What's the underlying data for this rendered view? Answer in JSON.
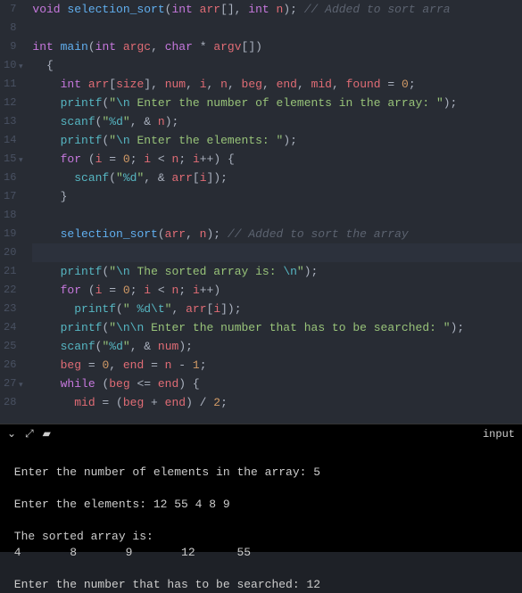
{
  "editor": {
    "lines": [
      {
        "num": "7",
        "fold": false,
        "tokens": [
          {
            "t": "void ",
            "c": "kw-type"
          },
          {
            "t": "selection_sort",
            "c": "fn"
          },
          {
            "t": "(",
            "c": "punct"
          },
          {
            "t": "int ",
            "c": "kw-type"
          },
          {
            "t": "arr",
            "c": "ident"
          },
          {
            "t": "[], ",
            "c": "punct"
          },
          {
            "t": "int ",
            "c": "kw-type"
          },
          {
            "t": "n",
            "c": "ident"
          },
          {
            "t": "); ",
            "c": "punct"
          },
          {
            "t": "// Added to sort arra",
            "c": "cmt"
          }
        ]
      },
      {
        "num": "8",
        "fold": false,
        "tokens": []
      },
      {
        "num": "9",
        "fold": false,
        "tokens": [
          {
            "t": "int ",
            "c": "kw-type"
          },
          {
            "t": "main",
            "c": "fn"
          },
          {
            "t": "(",
            "c": "punct"
          },
          {
            "t": "int ",
            "c": "kw-type"
          },
          {
            "t": "argc",
            "c": "ident"
          },
          {
            "t": ", ",
            "c": "punct"
          },
          {
            "t": "char ",
            "c": "kw-type"
          },
          {
            "t": "* ",
            "c": "op"
          },
          {
            "t": "argv",
            "c": "ident"
          },
          {
            "t": "[])",
            "c": "punct"
          }
        ]
      },
      {
        "num": "10",
        "fold": true,
        "tokens": [
          {
            "t": "  {",
            "c": "punct"
          }
        ]
      },
      {
        "num": "11",
        "fold": false,
        "tokens": [
          {
            "t": "    ",
            "c": "plain"
          },
          {
            "t": "int ",
            "c": "kw-type"
          },
          {
            "t": "arr",
            "c": "ident"
          },
          {
            "t": "[",
            "c": "punct"
          },
          {
            "t": "size",
            "c": "ident"
          },
          {
            "t": "], ",
            "c": "punct"
          },
          {
            "t": "num",
            "c": "ident"
          },
          {
            "t": ", ",
            "c": "punct"
          },
          {
            "t": "i",
            "c": "ident"
          },
          {
            "t": ", ",
            "c": "punct"
          },
          {
            "t": "n",
            "c": "ident"
          },
          {
            "t": ", ",
            "c": "punct"
          },
          {
            "t": "beg",
            "c": "ident"
          },
          {
            "t": ", ",
            "c": "punct"
          },
          {
            "t": "end",
            "c": "ident"
          },
          {
            "t": ", ",
            "c": "punct"
          },
          {
            "t": "mid",
            "c": "ident"
          },
          {
            "t": ", ",
            "c": "punct"
          },
          {
            "t": "found",
            "c": "ident"
          },
          {
            "t": " = ",
            "c": "op"
          },
          {
            "t": "0",
            "c": "num"
          },
          {
            "t": ";",
            "c": "punct"
          }
        ]
      },
      {
        "num": "12",
        "fold": false,
        "tokens": [
          {
            "t": "    ",
            "c": "plain"
          },
          {
            "t": "printf",
            "c": "fn-call"
          },
          {
            "t": "(",
            "c": "punct"
          },
          {
            "t": "\"",
            "c": "str"
          },
          {
            "t": "\\n",
            "c": "esc"
          },
          {
            "t": " Enter the number of elements in the array: ",
            "c": "str"
          },
          {
            "t": "\"",
            "c": "str"
          },
          {
            "t": ");",
            "c": "punct"
          }
        ]
      },
      {
        "num": "13",
        "fold": false,
        "tokens": [
          {
            "t": "    ",
            "c": "plain"
          },
          {
            "t": "scanf",
            "c": "fn-call"
          },
          {
            "t": "(",
            "c": "punct"
          },
          {
            "t": "\"",
            "c": "str"
          },
          {
            "t": "%d",
            "c": "esc"
          },
          {
            "t": "\"",
            "c": "str"
          },
          {
            "t": ", & ",
            "c": "punct"
          },
          {
            "t": "n",
            "c": "ident"
          },
          {
            "t": ");",
            "c": "punct"
          }
        ]
      },
      {
        "num": "14",
        "fold": false,
        "tokens": [
          {
            "t": "    ",
            "c": "plain"
          },
          {
            "t": "printf",
            "c": "fn-call"
          },
          {
            "t": "(",
            "c": "punct"
          },
          {
            "t": "\"",
            "c": "str"
          },
          {
            "t": "\\n",
            "c": "esc"
          },
          {
            "t": " Enter the elements: ",
            "c": "str"
          },
          {
            "t": "\"",
            "c": "str"
          },
          {
            "t": ");",
            "c": "punct"
          }
        ]
      },
      {
        "num": "15",
        "fold": true,
        "tokens": [
          {
            "t": "    ",
            "c": "plain"
          },
          {
            "t": "for ",
            "c": "kw-ctrl"
          },
          {
            "t": "(",
            "c": "punct"
          },
          {
            "t": "i",
            "c": "ident"
          },
          {
            "t": " = ",
            "c": "op"
          },
          {
            "t": "0",
            "c": "num"
          },
          {
            "t": "; ",
            "c": "punct"
          },
          {
            "t": "i",
            "c": "ident"
          },
          {
            "t": " < ",
            "c": "op"
          },
          {
            "t": "n",
            "c": "ident"
          },
          {
            "t": "; ",
            "c": "punct"
          },
          {
            "t": "i",
            "c": "ident"
          },
          {
            "t": "++",
            "c": "op"
          },
          {
            "t": ") {",
            "c": "punct"
          }
        ]
      },
      {
        "num": "16",
        "fold": false,
        "tokens": [
          {
            "t": "      ",
            "c": "plain"
          },
          {
            "t": "scanf",
            "c": "fn-call"
          },
          {
            "t": "(",
            "c": "punct"
          },
          {
            "t": "\"",
            "c": "str"
          },
          {
            "t": "%d",
            "c": "esc"
          },
          {
            "t": "\"",
            "c": "str"
          },
          {
            "t": ", & ",
            "c": "punct"
          },
          {
            "t": "arr",
            "c": "ident"
          },
          {
            "t": "[",
            "c": "punct"
          },
          {
            "t": "i",
            "c": "ident"
          },
          {
            "t": "]);",
            "c": "punct"
          }
        ]
      },
      {
        "num": "17",
        "fold": false,
        "tokens": [
          {
            "t": "    }",
            "c": "punct"
          }
        ]
      },
      {
        "num": "18",
        "fold": false,
        "tokens": []
      },
      {
        "num": "19",
        "fold": false,
        "tokens": [
          {
            "t": "    ",
            "c": "plain"
          },
          {
            "t": "selection_sort",
            "c": "fn"
          },
          {
            "t": "(",
            "c": "punct"
          },
          {
            "t": "arr",
            "c": "ident"
          },
          {
            "t": ", ",
            "c": "punct"
          },
          {
            "t": "n",
            "c": "ident"
          },
          {
            "t": "); ",
            "c": "punct"
          },
          {
            "t": "// Added to sort the array",
            "c": "cmt"
          }
        ]
      },
      {
        "num": "20",
        "fold": false,
        "active": true,
        "tokens": []
      },
      {
        "num": "21",
        "fold": false,
        "tokens": [
          {
            "t": "    ",
            "c": "plain"
          },
          {
            "t": "printf",
            "c": "fn-call"
          },
          {
            "t": "(",
            "c": "punct"
          },
          {
            "t": "\"",
            "c": "str"
          },
          {
            "t": "\\n",
            "c": "esc"
          },
          {
            "t": " The sorted array is: ",
            "c": "str"
          },
          {
            "t": "\\n",
            "c": "esc"
          },
          {
            "t": "\"",
            "c": "str"
          },
          {
            "t": ");",
            "c": "punct"
          }
        ]
      },
      {
        "num": "22",
        "fold": false,
        "tokens": [
          {
            "t": "    ",
            "c": "plain"
          },
          {
            "t": "for ",
            "c": "kw-ctrl"
          },
          {
            "t": "(",
            "c": "punct"
          },
          {
            "t": "i",
            "c": "ident"
          },
          {
            "t": " = ",
            "c": "op"
          },
          {
            "t": "0",
            "c": "num"
          },
          {
            "t": "; ",
            "c": "punct"
          },
          {
            "t": "i",
            "c": "ident"
          },
          {
            "t": " < ",
            "c": "op"
          },
          {
            "t": "n",
            "c": "ident"
          },
          {
            "t": "; ",
            "c": "punct"
          },
          {
            "t": "i",
            "c": "ident"
          },
          {
            "t": "++",
            "c": "op"
          },
          {
            "t": ")",
            "c": "punct"
          }
        ]
      },
      {
        "num": "23",
        "fold": false,
        "tokens": [
          {
            "t": "      ",
            "c": "plain"
          },
          {
            "t": "printf",
            "c": "fn-call"
          },
          {
            "t": "(",
            "c": "punct"
          },
          {
            "t": "\" ",
            "c": "str"
          },
          {
            "t": "%d\\t",
            "c": "esc"
          },
          {
            "t": "\"",
            "c": "str"
          },
          {
            "t": ", ",
            "c": "punct"
          },
          {
            "t": "arr",
            "c": "ident"
          },
          {
            "t": "[",
            "c": "punct"
          },
          {
            "t": "i",
            "c": "ident"
          },
          {
            "t": "]);",
            "c": "punct"
          }
        ]
      },
      {
        "num": "24",
        "fold": false,
        "tokens": [
          {
            "t": "    ",
            "c": "plain"
          },
          {
            "t": "printf",
            "c": "fn-call"
          },
          {
            "t": "(",
            "c": "punct"
          },
          {
            "t": "\"",
            "c": "str"
          },
          {
            "t": "\\n\\n",
            "c": "esc"
          },
          {
            "t": " Enter the number that has to be searched: ",
            "c": "str"
          },
          {
            "t": "\"",
            "c": "str"
          },
          {
            "t": ");",
            "c": "punct"
          }
        ]
      },
      {
        "num": "25",
        "fold": false,
        "tokens": [
          {
            "t": "    ",
            "c": "plain"
          },
          {
            "t": "scanf",
            "c": "fn-call"
          },
          {
            "t": "(",
            "c": "punct"
          },
          {
            "t": "\"",
            "c": "str"
          },
          {
            "t": "%d",
            "c": "esc"
          },
          {
            "t": "\"",
            "c": "str"
          },
          {
            "t": ", & ",
            "c": "punct"
          },
          {
            "t": "num",
            "c": "ident"
          },
          {
            "t": ");",
            "c": "punct"
          }
        ]
      },
      {
        "num": "26",
        "fold": false,
        "tokens": [
          {
            "t": "    ",
            "c": "plain"
          },
          {
            "t": "beg",
            "c": "ident"
          },
          {
            "t": " = ",
            "c": "op"
          },
          {
            "t": "0",
            "c": "num"
          },
          {
            "t": ", ",
            "c": "punct"
          },
          {
            "t": "end",
            "c": "ident"
          },
          {
            "t": " = ",
            "c": "op"
          },
          {
            "t": "n",
            "c": "ident"
          },
          {
            "t": " - ",
            "c": "op"
          },
          {
            "t": "1",
            "c": "num"
          },
          {
            "t": ";",
            "c": "punct"
          }
        ]
      },
      {
        "num": "27",
        "fold": true,
        "tokens": [
          {
            "t": "    ",
            "c": "plain"
          },
          {
            "t": "while ",
            "c": "kw-ctrl"
          },
          {
            "t": "(",
            "c": "punct"
          },
          {
            "t": "beg",
            "c": "ident"
          },
          {
            "t": " <= ",
            "c": "op"
          },
          {
            "t": "end",
            "c": "ident"
          },
          {
            "t": ") {",
            "c": "punct"
          }
        ]
      },
      {
        "num": "28",
        "fold": false,
        "tokens": [
          {
            "t": "      ",
            "c": "plain"
          },
          {
            "t": "mid",
            "c": "ident"
          },
          {
            "t": " = (",
            "c": "punct"
          },
          {
            "t": "beg",
            "c": "ident"
          },
          {
            "t": " + ",
            "c": "op"
          },
          {
            "t": "end",
            "c": "ident"
          },
          {
            "t": ") / ",
            "c": "op"
          },
          {
            "t": "2",
            "c": "num"
          },
          {
            "t": ";",
            "c": "punct"
          }
        ]
      }
    ]
  },
  "toolbar": {
    "input_label": "input"
  },
  "terminal": {
    "lines": [
      "",
      " Enter the number of elements in the array: 5",
      "",
      " Enter the elements: 12 55 4 8 9",
      "",
      " The sorted array is: ",
      " 4\t 8\t 9\t 12\t 55\t",
      "",
      " Enter the number that has to be searched: 12"
    ]
  }
}
